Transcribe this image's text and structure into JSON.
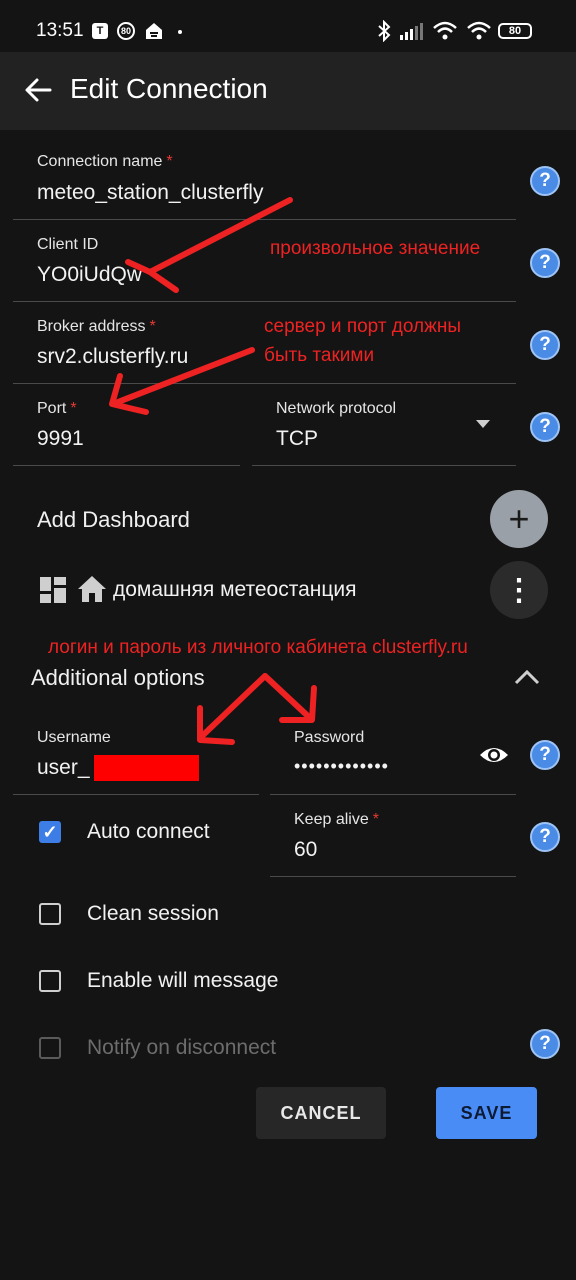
{
  "status_bar": {
    "time": "13:51",
    "notif_1": "T",
    "notif_2": "80",
    "battery": "80"
  },
  "header": {
    "title": "Edit Connection"
  },
  "fields": {
    "connection_name": {
      "label": "Connection name",
      "required": "*",
      "value": "meteo_station_clusterfly"
    },
    "client_id": {
      "label": "Client ID",
      "value": "YO0iUdQw"
    },
    "broker_address": {
      "label": "Broker address",
      "required": "*",
      "value": "srv2.clusterfly.ru"
    },
    "port": {
      "label": "Port",
      "required": "*",
      "value": "9991"
    },
    "network_protocol": {
      "label": "Network protocol",
      "value": "TCP"
    }
  },
  "dashboard": {
    "add_label": "Add Dashboard",
    "item_label": "домашняя метеостанция",
    "add_glyph": "+",
    "menu_glyph": "⋮"
  },
  "annotations": {
    "client_id_note": "произвольное значение",
    "broker_note_1": "сервер и порт должны",
    "broker_note_2": "быть такими",
    "credentials_note": "логин и пароль из личного кабинета clusterfly.ru"
  },
  "additional_options": {
    "title": "Additional options",
    "username": {
      "label": "Username",
      "value": "user_"
    },
    "password": {
      "label": "Password",
      "value": "•••••••••••••"
    },
    "auto_connect": {
      "label": "Auto connect",
      "checked": true
    },
    "keep_alive": {
      "label": "Keep alive",
      "required": "*",
      "value": "60"
    },
    "clean_session": {
      "label": "Clean session",
      "checked": false
    },
    "enable_will": {
      "label": "Enable will message",
      "checked": false
    },
    "notify_disconnect": {
      "label": "Notify on disconnect",
      "checked": false,
      "disabled": true
    }
  },
  "buttons": {
    "cancel": "CANCEL",
    "save": "SAVE"
  },
  "help_glyph": "?",
  "icons": [
    "back-arrow-icon",
    "help-icon",
    "dropdown-arrow-icon",
    "add-icon",
    "more-vert-icon",
    "dashboard-grid-icon",
    "home-icon",
    "chevron-up-icon",
    "eye-icon",
    "check-icon",
    "bluetooth-icon",
    "wifi-icon",
    "signal-icon"
  ],
  "colors": {
    "accent": "#3d7de6",
    "annotation": "#ee2222",
    "appbar": "#222222",
    "background": "#141414"
  }
}
